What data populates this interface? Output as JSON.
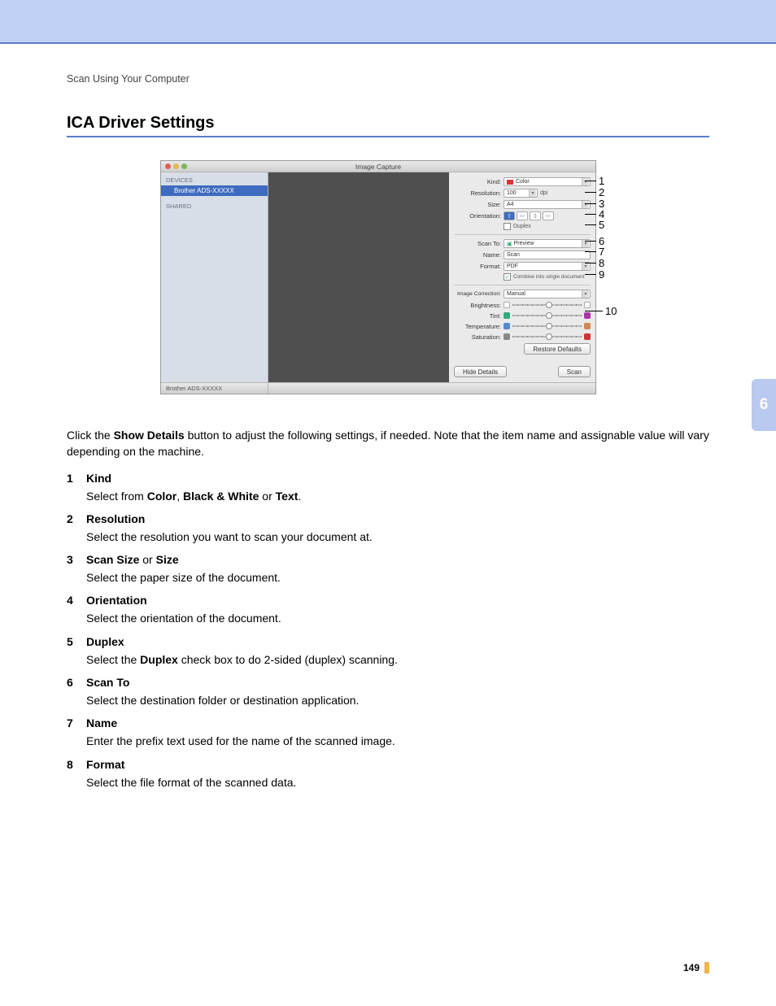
{
  "header": {
    "breadcrumb": "Scan Using Your Computer",
    "title": "ICA Driver Settings"
  },
  "chapter_tab": "6",
  "page_number": "149",
  "screenshot": {
    "window_title": "Image Capture",
    "sidebar": {
      "devices_label": "DEVICES",
      "device_item": "Brother ADS-XXXXX",
      "shared_label": "SHARED",
      "status": "Brother ADS-XXXXX"
    },
    "settings": {
      "kind_label": "Kind:",
      "kind_value": "Color",
      "resolution_label": "Resolution:",
      "resolution_value": "100",
      "resolution_unit": "dpi",
      "size_label": "Size:",
      "size_value": "A4",
      "orientation_label": "Orientation:",
      "duplex_label": "Duplex",
      "scan_to_label": "Scan To:",
      "scan_to_value": "Preview",
      "name_label": "Name:",
      "name_value": "Scan",
      "format_label": "Format:",
      "format_value": "PDF",
      "combine_label": "Combine into single document",
      "image_correction_label": "Image Correction:",
      "image_correction_value": "Manual",
      "brightness_label": "Brightness:",
      "tint_label": "Tint:",
      "temperature_label": "Temperature:",
      "saturation_label": "Saturation:",
      "restore_defaults": "Restore Defaults",
      "hide_details": "Hide Details",
      "scan_button": "Scan"
    },
    "callouts": [
      "1",
      "2",
      "3",
      "4",
      "5",
      "6",
      "7",
      "8",
      "9",
      "10"
    ]
  },
  "intro": {
    "pre": "Click the ",
    "bold": "Show Details",
    "post": " button to adjust the following settings, if needed. Note that the item name and assignable value will vary depending on the machine."
  },
  "items": [
    {
      "n": "1",
      "head": "Kind",
      "body_pre": "Select from ",
      "b1": "Color",
      "sep1": ", ",
      "b2": "Black & White",
      "sep2": " or ",
      "b3": "Text",
      "post": "."
    },
    {
      "n": "2",
      "head": "Resolution",
      "body": "Select the resolution you want to scan your document at."
    },
    {
      "n": "3",
      "head_pre": "Scan Size",
      "head_mid": " or ",
      "head_post": "Size",
      "body": "Select the paper size of the document."
    },
    {
      "n": "4",
      "head": "Orientation",
      "body": "Select the orientation of the document."
    },
    {
      "n": "5",
      "head": "Duplex",
      "body_pre": "Select the ",
      "b1": "Duplex",
      "post": " check box to do 2-sided (duplex) scanning."
    },
    {
      "n": "6",
      "head": "Scan To",
      "body": "Select the destination folder or destination application."
    },
    {
      "n": "7",
      "head": "Name",
      "body": "Enter the prefix text used for the name of the scanned image."
    },
    {
      "n": "8",
      "head": "Format",
      "body": "Select the file format of the scanned data."
    }
  ]
}
